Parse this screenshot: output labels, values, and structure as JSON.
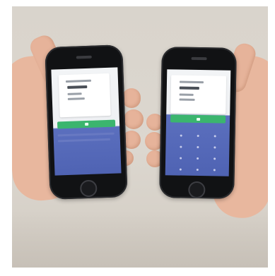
{
  "scene": {
    "description_colors": {
      "wall": "#dcd7cf",
      "phone_body": "#111214",
      "screen_light": "#f2f4f6",
      "screen_blue": "#5063b4",
      "button_green": "#3bb56e",
      "skin": "#e8b79e"
    }
  }
}
